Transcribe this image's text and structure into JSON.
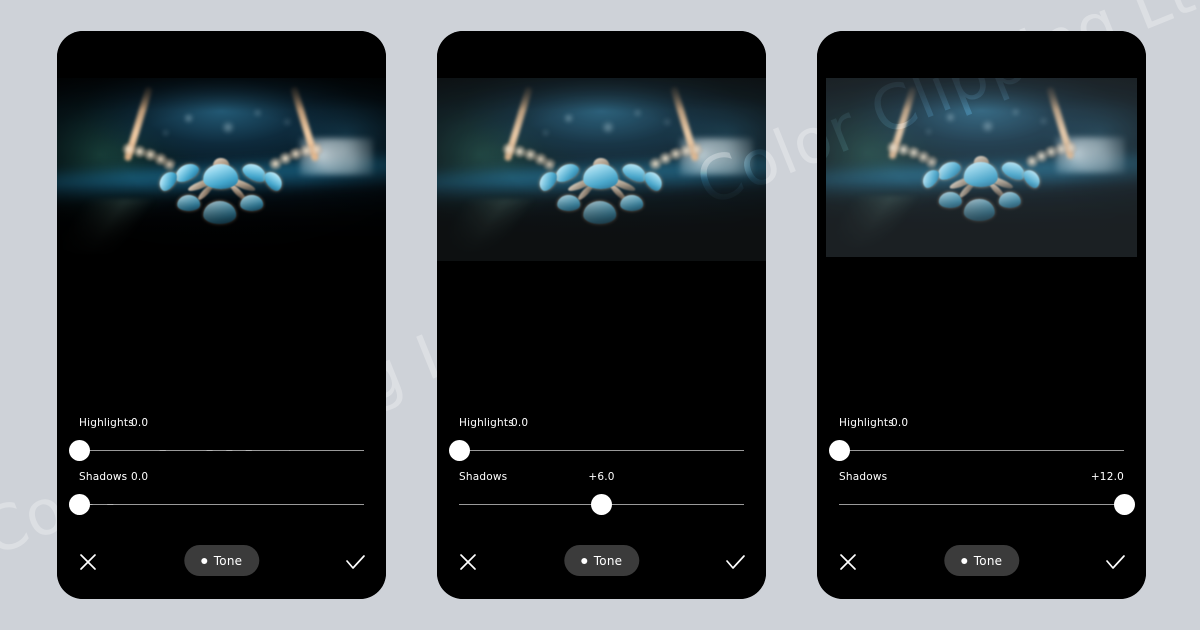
{
  "background_color": "#ced2d8",
  "watermark": {
    "text": "Color Clipping Ltd.",
    "color": "#ffffff"
  },
  "photo": {
    "subject": "aquamarine and rose-gold necklace on dark teal fabric",
    "alt": "Blue gemstone necklace product photo"
  },
  "panels": [
    {
      "id": "before",
      "sliders": [
        {
          "name": "highlights",
          "label": "Highlights",
          "value": "0.0",
          "knob_percent": 0,
          "value_align": "inline"
        },
        {
          "name": "shadows",
          "label": "Shadows",
          "value": "0.0",
          "knob_percent": 0,
          "value_align": "inline"
        }
      ],
      "toolbar": {
        "close_label": "Cancel",
        "done_label": "Done",
        "tone_label": "Tone"
      }
    },
    {
      "id": "mid",
      "sliders": [
        {
          "name": "highlights",
          "label": "Highlights",
          "value": "0.0",
          "knob_percent": 0,
          "value_align": "inline"
        },
        {
          "name": "shadows",
          "label": "Shadows",
          "value": "+6.0",
          "knob_percent": 50,
          "value_align": "center"
        }
      ],
      "toolbar": {
        "close_label": "Cancel",
        "done_label": "Done",
        "tone_label": "Tone"
      }
    },
    {
      "id": "after",
      "sliders": [
        {
          "name": "highlights",
          "label": "Highlights",
          "value": "0.0",
          "knob_percent": 0,
          "value_align": "inline"
        },
        {
          "name": "shadows",
          "label": "Shadows",
          "value": "+12.0",
          "knob_percent": 100,
          "value_align": "right"
        }
      ],
      "toolbar": {
        "close_label": "Cancel",
        "done_label": "Done",
        "tone_label": "Tone"
      }
    }
  ],
  "colors": {
    "screen_bg": "#000000",
    "track": "#9a9a9a",
    "knob": "#ffffff",
    "pill": "#3b3b3b",
    "text": "#ffffff"
  }
}
